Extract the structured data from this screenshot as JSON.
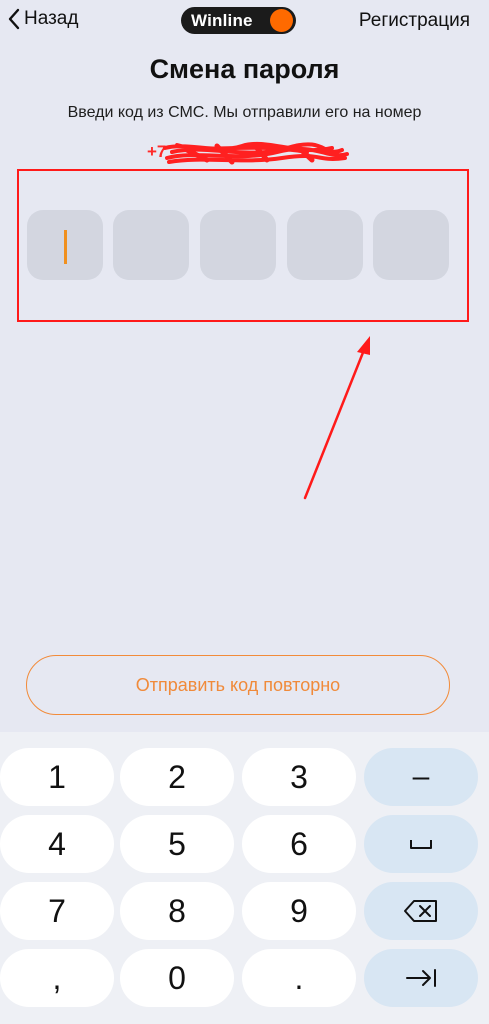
{
  "header": {
    "back_label": "Назад",
    "logo_text": "Winline",
    "register_label": "Регистрация"
  },
  "title": "Смена пароля",
  "subtitle": "Введи код из СМС. Мы отправили его на номер",
  "phone_prefix": "+7",
  "code_cells": [
    {
      "index": 1,
      "value": "",
      "active": true
    },
    {
      "index": 2,
      "value": "",
      "active": false
    },
    {
      "index": 3,
      "value": "",
      "active": false
    },
    {
      "index": 4,
      "value": "",
      "active": false
    },
    {
      "index": 5,
      "value": "",
      "active": false
    }
  ],
  "resend_label": "Отправить код повторно",
  "keyboard": {
    "rows": [
      [
        "1",
        "2",
        "3",
        "–"
      ],
      [
        "4",
        "5",
        "6",
        "␣"
      ],
      [
        "7",
        "8",
        "9",
        "⌫"
      ],
      [
        ",",
        "0",
        ".",
        "⇥"
      ]
    ],
    "function_icons": [
      "minus-icon",
      "space-icon",
      "backspace-icon",
      "tab-icon"
    ]
  },
  "colors": {
    "background": "#e6e8f2",
    "accent": "#f08a3a",
    "annotation": "#ff1a1a",
    "logo_dot": "#ff6a00"
  }
}
